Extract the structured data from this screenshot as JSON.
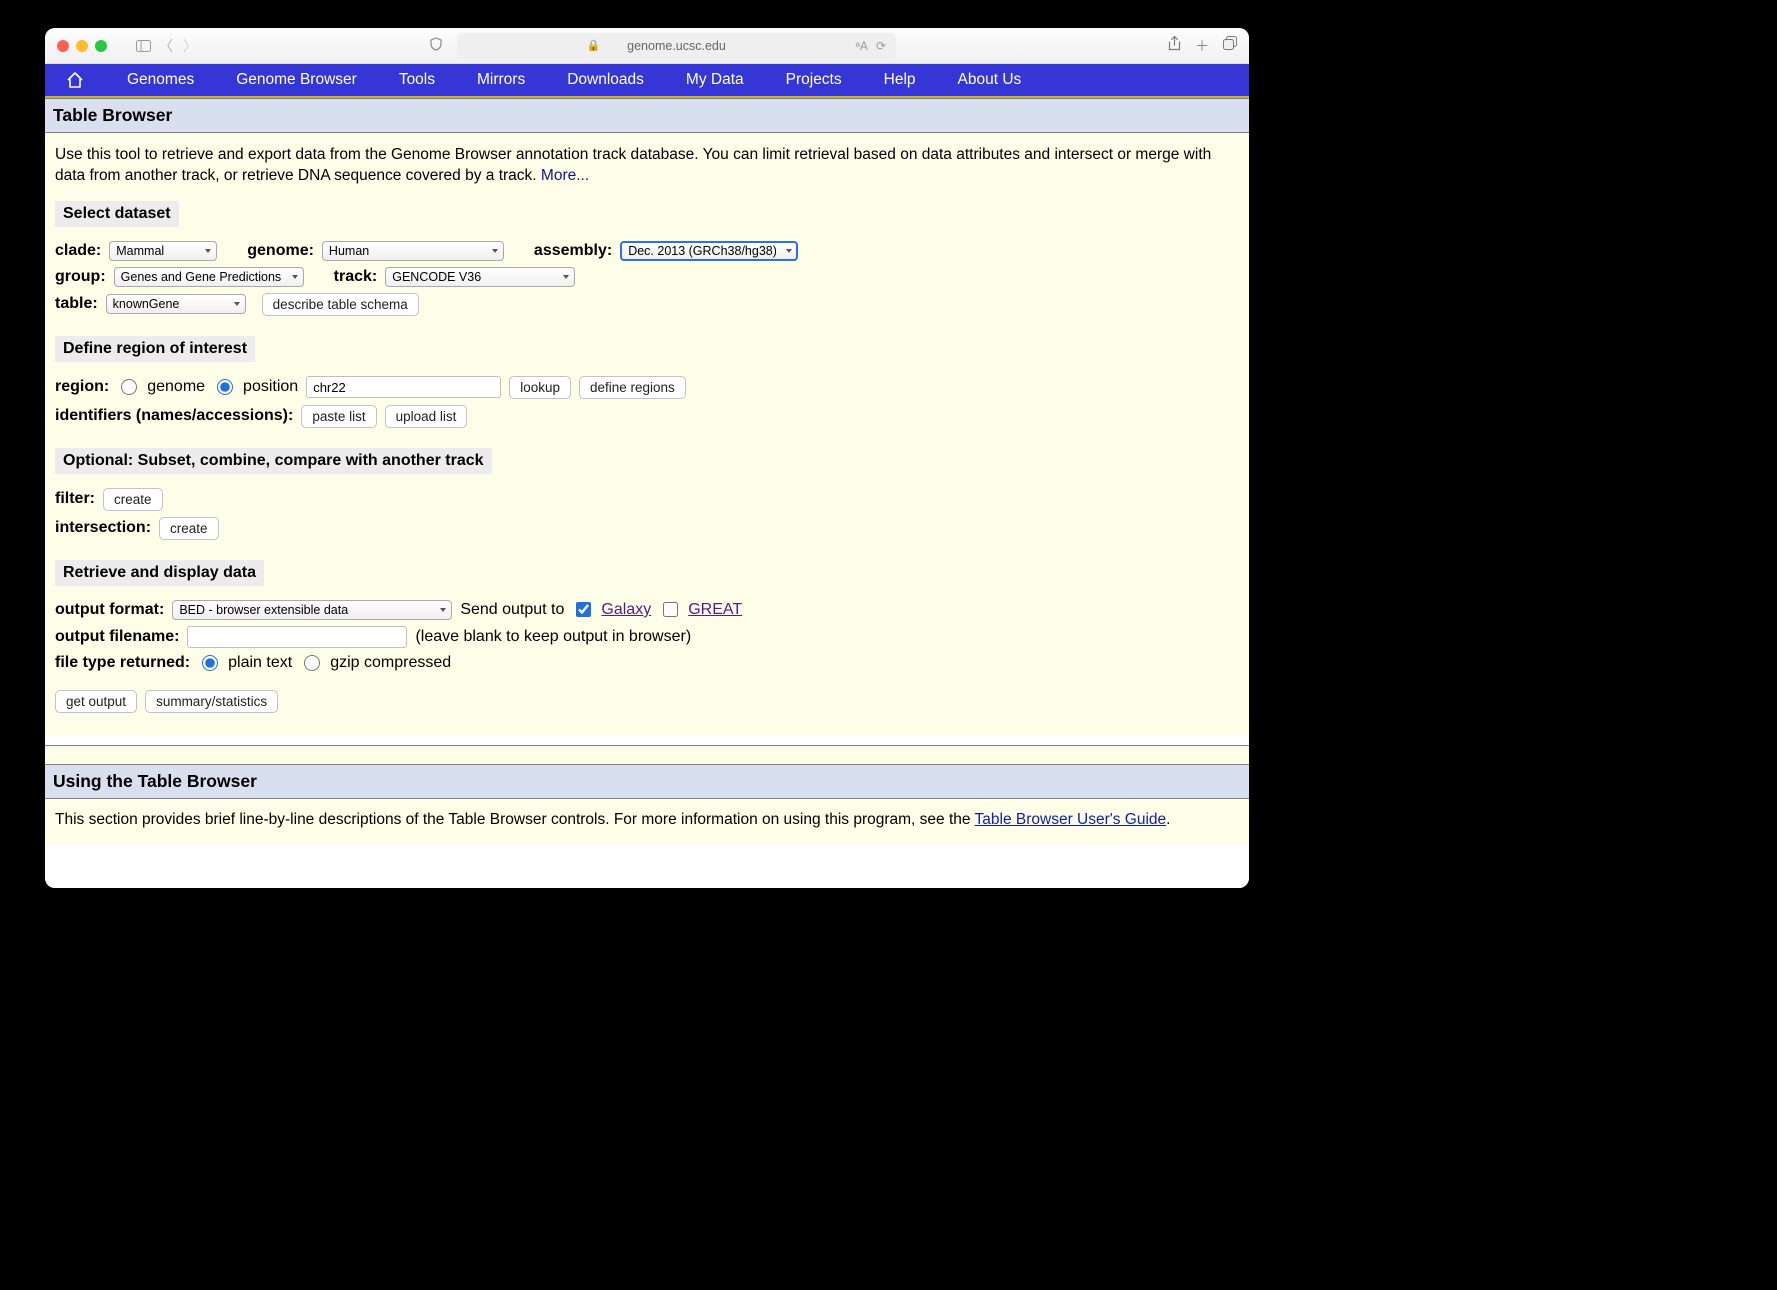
{
  "browser": {
    "url": "genome.ucsc.edu"
  },
  "menubar": {
    "items": [
      "Genomes",
      "Genome Browser",
      "Tools",
      "Mirrors",
      "Downloads",
      "My Data",
      "Projects",
      "Help",
      "About Us"
    ]
  },
  "header1": "Table Browser",
  "intro": {
    "text": "Use this tool to retrieve and export data from the Genome Browser annotation track database. You can limit retrieval based on data attributes and intersect or merge with data from another track, or retrieve DNA sequence covered by a track. ",
    "more": "More..."
  },
  "sub": {
    "dataset": "Select dataset",
    "region": "Define region of interest",
    "optional": "Optional: Subset, combine, compare with another track",
    "retrieve": "Retrieve and display data"
  },
  "labels": {
    "clade": "clade:",
    "genome": "genome:",
    "assembly": "assembly:",
    "group": "group:",
    "track": "track:",
    "table": "table:",
    "region": "region:",
    "identifiers": "identifiers (names/accessions):",
    "filter": "filter:",
    "intersection": "intersection:",
    "output_format": "output format:",
    "send_output": "Send output to",
    "output_filename": "output filename:",
    "filename_hint": "(leave blank to keep output in browser)",
    "file_type": "file type returned:"
  },
  "selects": {
    "clade": "Mammal",
    "genome": "Human",
    "assembly": "Dec. 2013 (GRCh38/hg38)",
    "group": "Genes and Gene Predictions",
    "track": "GENCODE V36",
    "table": "knownGene",
    "output_format": "BED - browser extensible data"
  },
  "buttons": {
    "describe": "describe table schema",
    "lookup": "lookup",
    "define_regions": "define regions",
    "paste_list": "paste list",
    "upload_list": "upload list",
    "create_filter": "create",
    "create_intersection": "create",
    "get_output": "get output",
    "summary": "summary/statistics"
  },
  "radios": {
    "genome": "genome",
    "position": "position",
    "plain_text": "plain text",
    "gzip": "gzip compressed"
  },
  "inputs": {
    "position_value": "chr22",
    "filename_value": ""
  },
  "links": {
    "galaxy": "Galaxy",
    "great": "GREAT",
    "tb_guide": "Table Browser User's Guide"
  },
  "header2": "Using the Table Browser",
  "footer_text": "This section provides brief line-by-line descriptions of the Table Browser controls. For more information on using this program, see the "
}
